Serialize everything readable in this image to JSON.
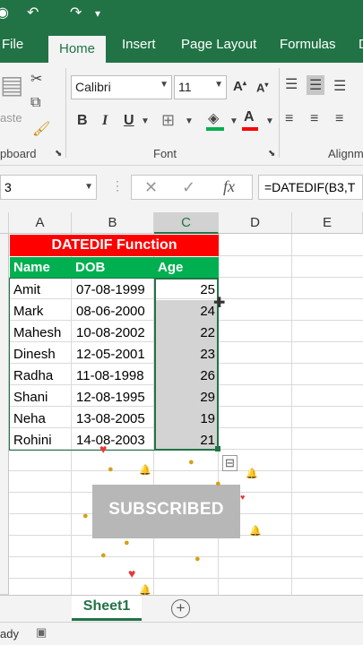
{
  "tabs": [
    "File",
    "Home",
    "Insert",
    "Page Layout",
    "Formulas",
    "D"
  ],
  "ribbon": {
    "font_name": "Calibri",
    "font_size": "11",
    "paste_label": "aste",
    "clipboard_label": "pboard",
    "font_group_label": "Font",
    "alignment_label": "Alignm",
    "bold": "B",
    "italic": "I",
    "underline": "U"
  },
  "formula_bar": {
    "name_box": "3",
    "formula": "=DATEDIF(B3,T"
  },
  "columns": [
    "A",
    "B",
    "C",
    "D",
    "E"
  ],
  "sheet": {
    "title": "DATEDIF Function",
    "headers": [
      "Name",
      "DOB",
      "Age"
    ],
    "rows": [
      {
        "name": "Amit",
        "dob": "07-08-1999",
        "age": "25"
      },
      {
        "name": "Mark",
        "dob": "08-06-2000",
        "age": "24"
      },
      {
        "name": "Mahesh",
        "dob": "10-08-2002",
        "age": "22"
      },
      {
        "name": "Dinesh",
        "dob": "12-05-2001",
        "age": "23"
      },
      {
        "name": "Radha",
        "dob": "11-08-1998",
        "age": "26"
      },
      {
        "name": "Shani",
        "dob": "12-08-1995",
        "age": "29"
      },
      {
        "name": "Neha",
        "dob": "13-08-2005",
        "age": "19"
      },
      {
        "name": "Rohini",
        "dob": "14-08-2003",
        "age": "21"
      }
    ]
  },
  "overlay": {
    "subscribed": "SUBSCRIBED"
  },
  "sheet_tab": "Sheet1",
  "status": "ady"
}
